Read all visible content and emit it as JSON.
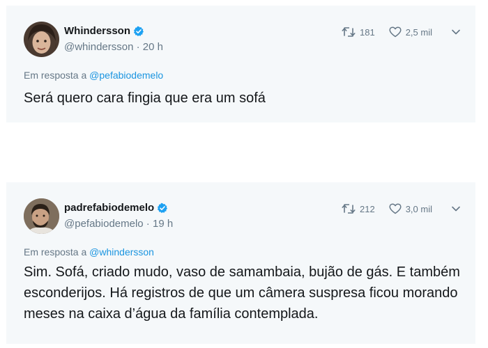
{
  "tweets": [
    {
      "display_name": "Whindersson",
      "handle": "@whindersson",
      "separator": " · ",
      "time": "20 h",
      "retweet_count": "181",
      "like_count": "2,5 mil",
      "reply_prefix": "Em resposta a ",
      "reply_to": "@pefabiodemelo",
      "text": "Será quero cara fingia que era um sofá",
      "avatar_icon": "avatar-whindersson",
      "verified_icon": "verified-badge-icon"
    },
    {
      "display_name": "padrefabiodemelo",
      "handle": "@pefabiodemelo",
      "separator": " · ",
      "time": "19 h",
      "retweet_count": "212",
      "like_count": "3,0 mil",
      "reply_prefix": "Em resposta a ",
      "reply_to": "@whindersson",
      "text": "Sim. Sofá, criado mudo, vaso de samambaia, bujão de gás. E também esconderijos. Há registros de que um câmera suspresa ficou morando meses na caixa d’água da família contemplada.",
      "avatar_icon": "avatar-padrefabiodemelo",
      "verified_icon": "verified-badge-icon"
    }
  ],
  "colors": {
    "card_background": "#f5f8fa",
    "text_primary": "#14171a",
    "text_secondary": "#657786",
    "link": "#1b95e0",
    "verified": "#1da1f2"
  }
}
